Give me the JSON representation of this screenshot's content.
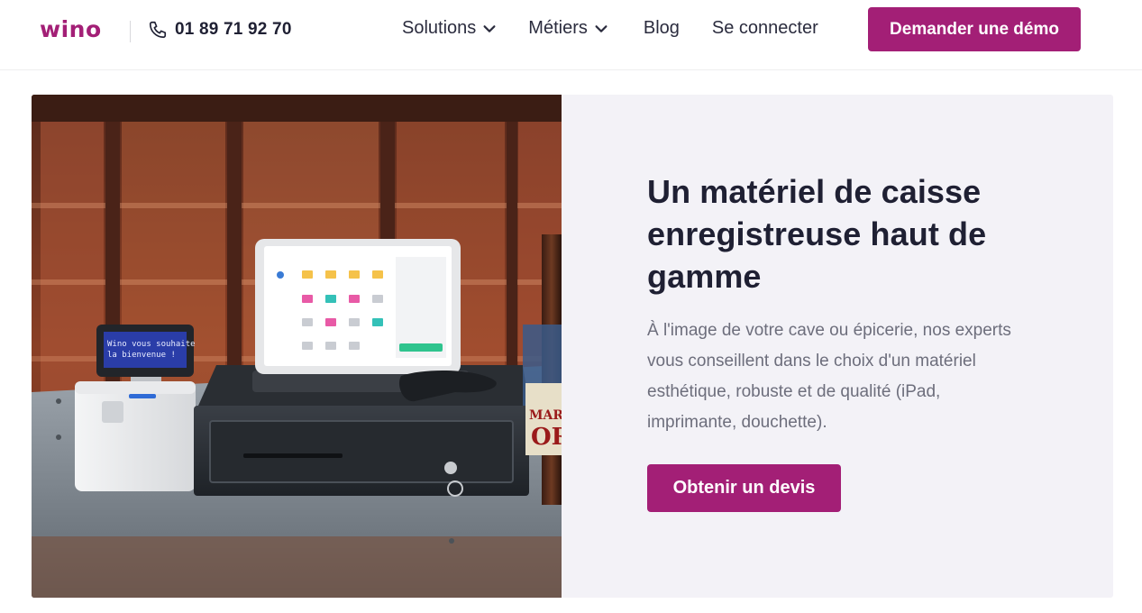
{
  "header": {
    "logo": "wino",
    "phone": "01 89 71 92 70",
    "nav": {
      "solutions": "Solutions",
      "metiers": "Métiers",
      "blog": "Blog",
      "login": "Se connecter"
    },
    "demo_button": "Demander une démo"
  },
  "hero": {
    "title": "Un matériel de caisse enregistreuse haut de gamme",
    "description": "À l'image de votre cave ou épicerie, nos experts vous conseillent dans le choix d'un matériel esthétique, robuste et de qualité (iPad, imprimante, douchette).",
    "cta_button": "Obtenir un devis",
    "photo": {
      "customer_display_text": "Wino vous souhaite la bienvenue !"
    }
  },
  "colors": {
    "brand": "#a31f76",
    "hero_background": "#f3f2f7",
    "heading": "#1f2033",
    "body_text": "#6d6e7c"
  }
}
